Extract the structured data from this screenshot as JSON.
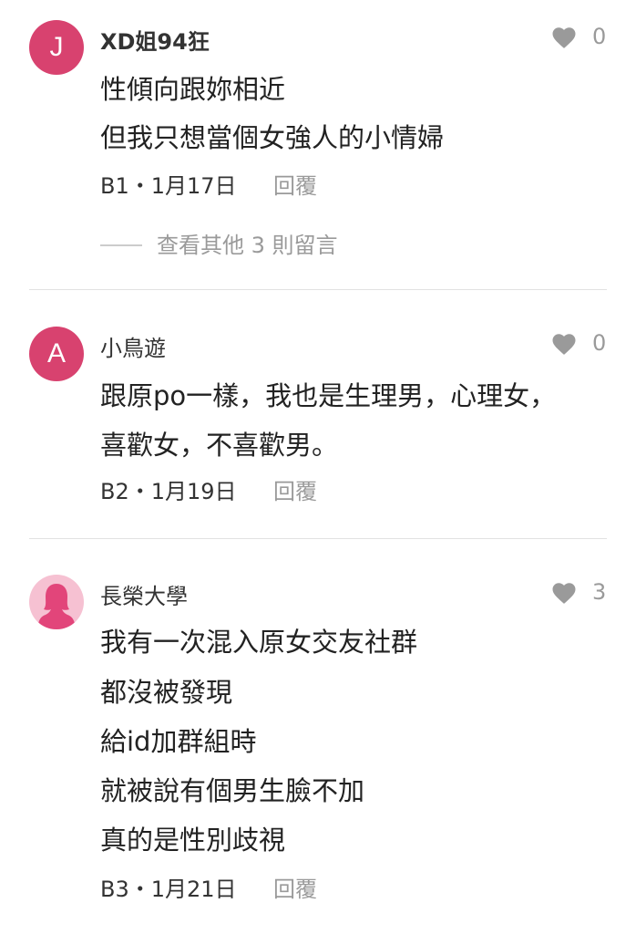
{
  "comments": [
    {
      "avatar_letter": "J",
      "author": "XD姐94狂",
      "likes": "0",
      "lines": [
        "性傾向跟妳相近",
        "但我只想當個女強人的小情婦"
      ],
      "floor": "B1",
      "date": "1月17日",
      "reply_label": "回覆",
      "more_replies": "查看其他 3 則留言"
    },
    {
      "avatar_letter": "A",
      "author": "小鳥遊",
      "likes": "0",
      "lines": [
        "跟原po一樣，我也是生理男，心理女，",
        "喜歡女，不喜歡男。"
      ],
      "floor": "B2",
      "date": "1月19日",
      "reply_label": "回覆"
    },
    {
      "avatar_letter": "",
      "author": "長榮大學",
      "likes": "3",
      "lines": [
        "我有一次混入原女交友社群",
        "都沒被發現",
        "給id加群組時",
        "就被說有個男生臉不加",
        "真的是性別歧視"
      ],
      "floor": "B3",
      "date": "1月21日",
      "reply_label": "回覆"
    }
  ],
  "meta_separator": "・",
  "colors": {
    "avatar_letter_bg": "#d8426f",
    "avatar_female_bg": "#f6c1d2",
    "avatar_female_fg": "#e2457a",
    "heart": "#9a9a9a"
  },
  "icons": {
    "like": "heart-icon",
    "female_avatar": "female-silhouette-icon"
  }
}
